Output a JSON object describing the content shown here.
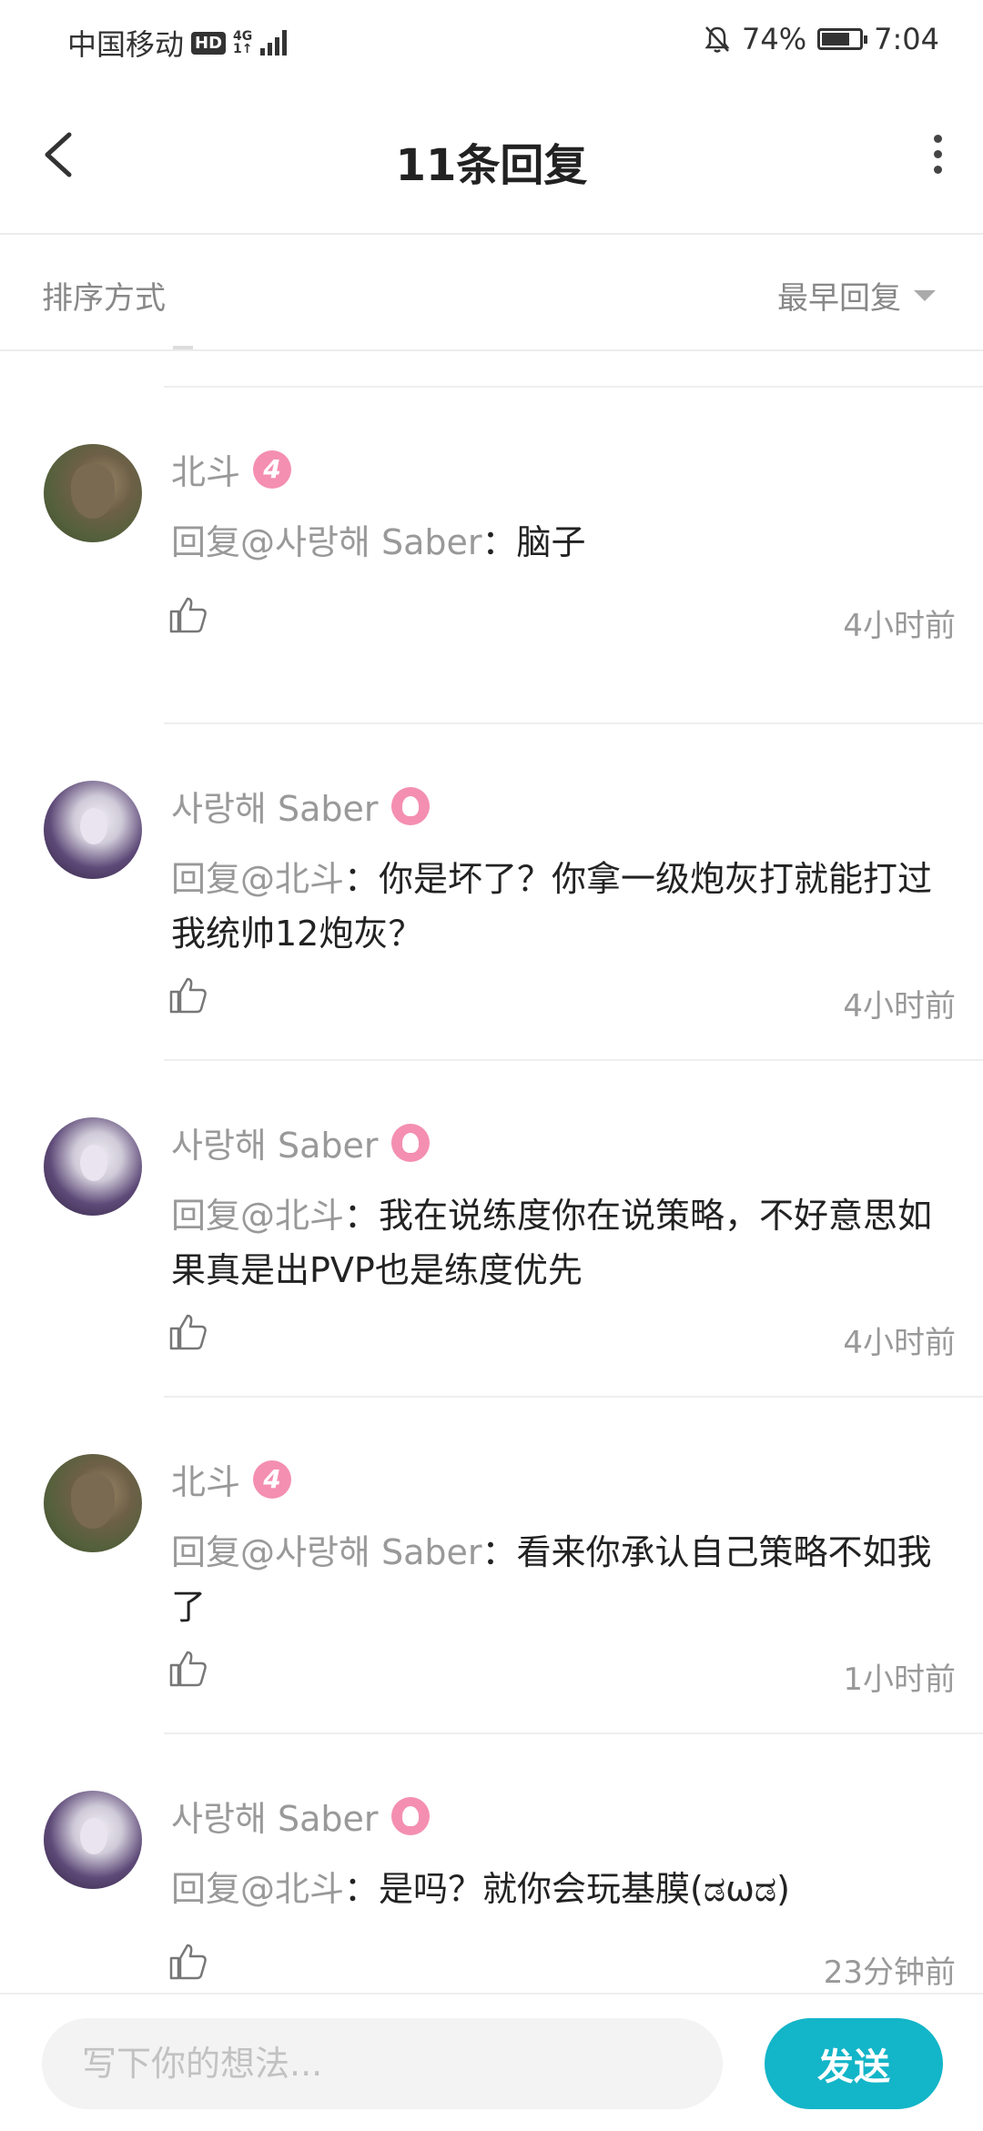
{
  "status_bar": {
    "carrier": "中国移动",
    "hd": "HD",
    "network_top": "4G",
    "network_bottom": "1↑",
    "battery_percent": "74%",
    "battery_level": 0.74,
    "time": "7:04"
  },
  "header": {
    "title": "11条回复"
  },
  "sort": {
    "label": "排序方式",
    "value": "最早回复"
  },
  "comments": [
    {
      "user": "北斗",
      "badge": "4",
      "avatar": "wolf",
      "mention": "回复@사랑해 Saber",
      "sep": "：",
      "body": "脑子",
      "time": "4小时前"
    },
    {
      "user": "사랑해 Saber",
      "badge": "",
      "avatar": "anime",
      "mention": "回复@北斗",
      "sep": "：",
      "body": "你是坏了？你拿一级炮灰打就能打过我统帅12炮灰？",
      "time": "4小时前"
    },
    {
      "user": "사랑해 Saber",
      "badge": "",
      "avatar": "anime",
      "mention": "回复@北斗",
      "sep": "：",
      "body": "我在说练度你在说策略，不好意思如果真是出PVP也是练度优先",
      "time": "4小时前"
    },
    {
      "user": "北斗",
      "badge": "4",
      "avatar": "wolf",
      "mention": "回复@사랑해 Saber",
      "sep": "：",
      "body": "看来你承认自己策略不如我了",
      "time": "1小时前"
    },
    {
      "user": "사랑해 Saber",
      "badge": "",
      "avatar": "anime",
      "mention": "回复@北斗",
      "sep": "：",
      "body": "是吗？就你会玩基膜(ಡωಡ)",
      "time": "23分钟前"
    }
  ],
  "composer": {
    "placeholder": "写下你的想法...",
    "value": "",
    "send_label": "发送"
  },
  "colors": {
    "accent": "#13b5c8",
    "badge_pink": "#f48fb1",
    "muted_text": "#999999"
  }
}
